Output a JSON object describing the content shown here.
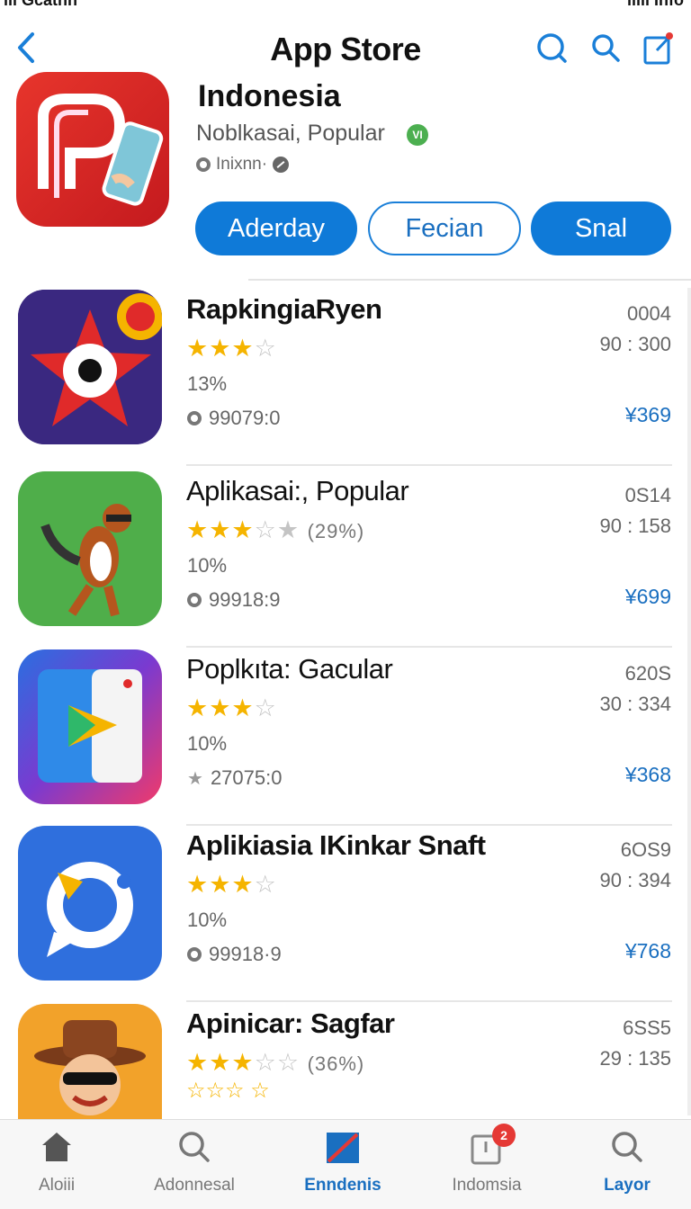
{
  "status": {
    "carrier": "ııl Gcatnn",
    "right": "ııııl Info"
  },
  "nav": {
    "title": "App Store"
  },
  "hero": {
    "title": "Indonesia",
    "subtitle": "Noblkasai, Popular",
    "badge": "VI",
    "meta": "Inixnn·",
    "buttons": [
      "Aderday",
      "Fecian",
      "Snal"
    ]
  },
  "apps": [
    {
      "name": "RapkingiaRyen",
      "stars": "★★★",
      "empty_stars": "☆",
      "rating_pct": "",
      "percent": "13%",
      "downloads": "99079:0",
      "code": "0004",
      "time": "90 : 300",
      "price": "¥369"
    },
    {
      "name": "Aplikasai:, Popular",
      "stars": "★★★",
      "empty_stars": "☆★",
      "rating_pct": "(29%)",
      "percent": "10%",
      "downloads": "99918:9",
      "code": "0S14",
      "time": "90 : 158",
      "price": "¥699"
    },
    {
      "name": "Poplkıta: Gacular",
      "stars": "★★★",
      "empty_stars": "☆",
      "rating_pct": "",
      "percent": "10%",
      "downloads": "27075:0",
      "code": "620S",
      "time": "30 : 334",
      "price": "¥368"
    },
    {
      "name": "Aplikiasia IKinkar Snaft",
      "stars": "★★★",
      "empty_stars": "☆",
      "rating_pct": "",
      "percent": "10%",
      "downloads": "99918·9",
      "code": "6OS9",
      "time": "90 : 394",
      "price": "¥768"
    },
    {
      "name": "Apinicar: Sagfar",
      "stars": "★★★",
      "empty_stars": "☆☆",
      "rating_pct": "(36%)",
      "extra_stars": "☆☆☆ ☆",
      "percent": "",
      "downloads": "",
      "code": "6SS5",
      "time": "29 : 135",
      "price": ""
    }
  ],
  "tabs": [
    {
      "label": "Aloiii",
      "icon": "home-icon"
    },
    {
      "label": "Adonnesal",
      "icon": "search-icon"
    },
    {
      "label": "Enndenis",
      "icon": "featured-icon"
    },
    {
      "label": "Indomsia",
      "icon": "updates-icon",
      "badge": "2"
    },
    {
      "label": "Layor",
      "icon": "search-icon"
    }
  ],
  "colors": {
    "accent": "#1a6fc0",
    "button": "#0f7ad8",
    "star": "#f5b400",
    "badge": "#e53935"
  }
}
